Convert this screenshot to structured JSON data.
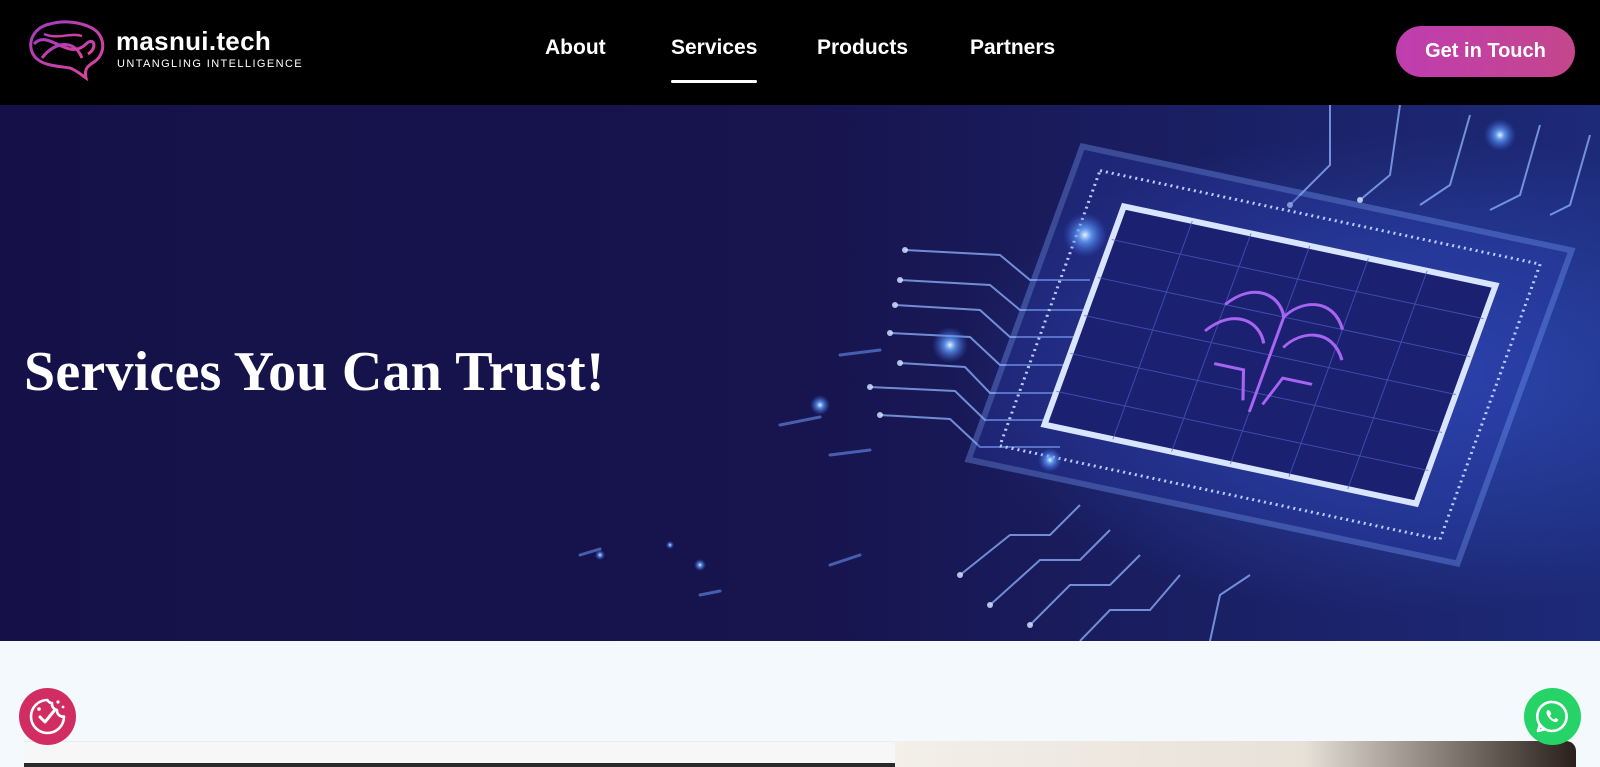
{
  "brand": {
    "name": "masnui.tech",
    "tagline": "UNTANGLING INTELLIGENCE",
    "logo_icon": "tangled-brain-speech-bubble-icon",
    "accent_color": "#c03db0"
  },
  "nav": {
    "items": [
      {
        "label": "About",
        "active": false
      },
      {
        "label": "Services",
        "active": true
      },
      {
        "label": "Products",
        "active": false
      },
      {
        "label": "Partners",
        "active": false
      }
    ]
  },
  "header": {
    "cta_label": "Get in Touch"
  },
  "hero": {
    "title": "Services You Can Trust!",
    "background": "circuit-chip-image",
    "background_color": "#151148"
  },
  "widgets": {
    "left_icon": "cookie-consent-icon",
    "left_color": "#d22d63",
    "right_icon": "whatsapp-icon",
    "right_color": "#25d366"
  }
}
